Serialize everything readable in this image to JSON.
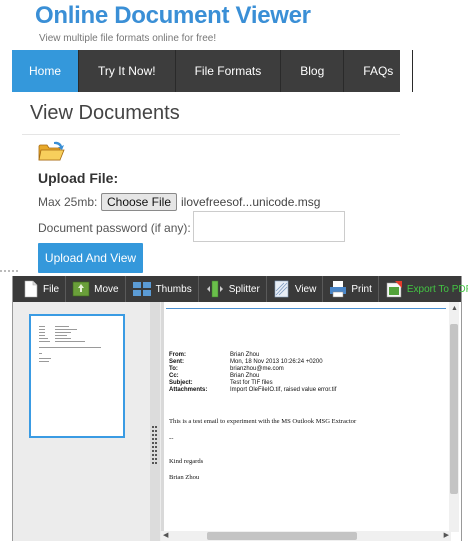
{
  "header": {
    "title": "Online Document Viewer",
    "tagline": "View multiple file formats online for free!"
  },
  "nav": {
    "items": [
      "Home",
      "Try It Now!",
      "File Formats",
      "Blog",
      "FAQs"
    ],
    "active": "Home"
  },
  "main": {
    "heading": "View Documents",
    "upload_label": "Upload File:",
    "max_size": "Max 25mb:",
    "choose_file_label": "Choose File",
    "file_name": "ilovefreesof...unicode.msg",
    "password_label": "Document password (if any):",
    "password_value": "",
    "upload_button": "Upload And View"
  },
  "viewer": {
    "toolbar": [
      "File",
      "Move",
      "Thumbs",
      "Splitter",
      "View",
      "Print",
      "Export To PDF"
    ],
    "email": {
      "headers": [
        {
          "key": "From:",
          "value": "Brian Zhou"
        },
        {
          "key": "Sent:",
          "value": "Mon, 18 Nov 2013 10:26:24 +0200"
        },
        {
          "key": "To:",
          "value": "brianzhou@me.com"
        },
        {
          "key": "Cc:",
          "value": "Brian Zhou"
        },
        {
          "key": "Subject:",
          "value": "Test for TIF files"
        },
        {
          "key": "Attachments:",
          "value": "Import OleFileIO.tif, raised value error.tif"
        }
      ],
      "body": [
        "This is a test email to experiment with the MS Outlook MSG Extractor",
        "--",
        "Kind regards",
        "Brian Zhou"
      ]
    }
  },
  "colors": {
    "accent": "#3498db",
    "nav_bg": "#3d3d3d",
    "export_green": "#43c543"
  }
}
